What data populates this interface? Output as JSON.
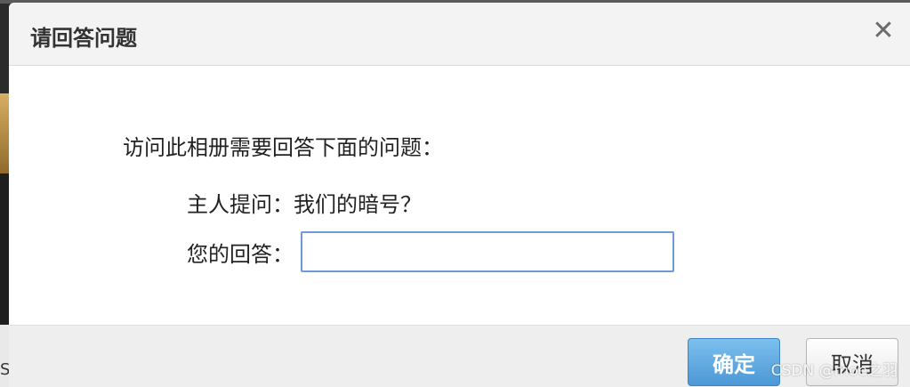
{
  "dialog": {
    "title": "请回答问题",
    "close_symbol": "✕",
    "prompt": "访问此相册需要回答下面的问题：",
    "question_label": "主人提问：",
    "question_text": "我们的暗号？",
    "answer_label": "您的回答：",
    "answer_value": "",
    "ok_label": "确定",
    "cancel_label": "取消"
  },
  "background": {
    "left_letter": "S"
  },
  "watermark": "CSDN @moe之羽",
  "colors": {
    "accent": "#4c97d6",
    "input_border": "#6f9ad6",
    "header_bg": "#f3f3f3"
  }
}
